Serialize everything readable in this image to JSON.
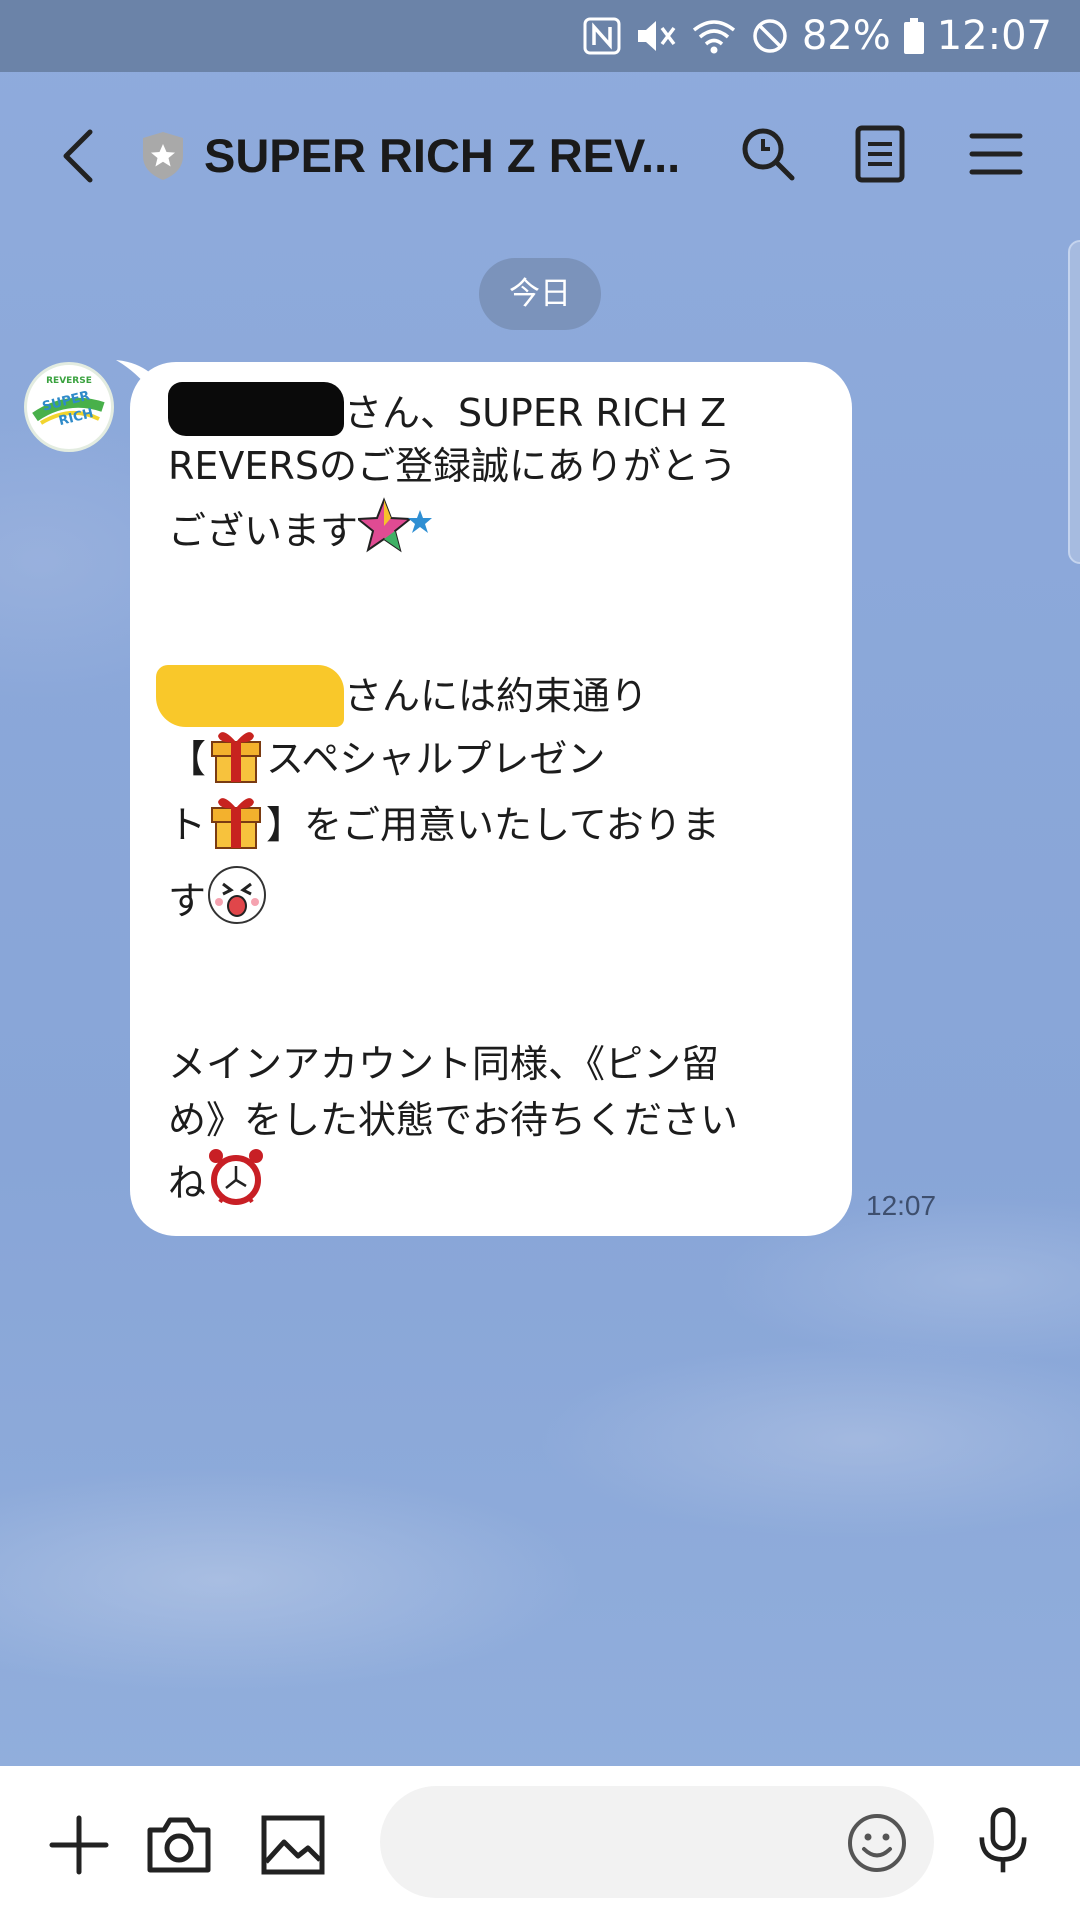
{
  "status_bar": {
    "battery": "82%",
    "time": "12:07",
    "icons": [
      "nfc-icon",
      "vibrate-icon",
      "wifi-icon",
      "do-not-disturb-icon",
      "battery-icon"
    ]
  },
  "header": {
    "title": "SUPER RICH Z REV...",
    "icons": [
      "back-icon",
      "shield-badge-icon",
      "search-icon",
      "notes-icon",
      "menu-icon"
    ]
  },
  "date_divider": "今日",
  "message": {
    "sender_avatar_text": "SUPER RICH",
    "avatar_caption": "REVERSE",
    "lines": [
      "さん、SUPER RICH Z",
      "REVERSのご登録誠にありがとう",
      "ございます",
      "さんには約束通り",
      "【",
      "スペシャルプレゼン",
      "ト",
      "】をご用意いたしておりま",
      "す",
      "メインアカウント同様、《ピン留",
      "め》をした状態でお待ちください",
      "ね"
    ],
    "time": "12:07"
  },
  "bottom_bar": {
    "input_placeholder": "",
    "icons": [
      "plus-icon",
      "camera-icon",
      "image-icon",
      "emoji-icon",
      "mic-icon"
    ]
  },
  "colors": {
    "status_bar": "#6b83a8",
    "background": "#8aa6d8",
    "bubble": "#ffffff",
    "date_pill": "#7b93bb",
    "redaction_yellow": "#f9c82a"
  }
}
